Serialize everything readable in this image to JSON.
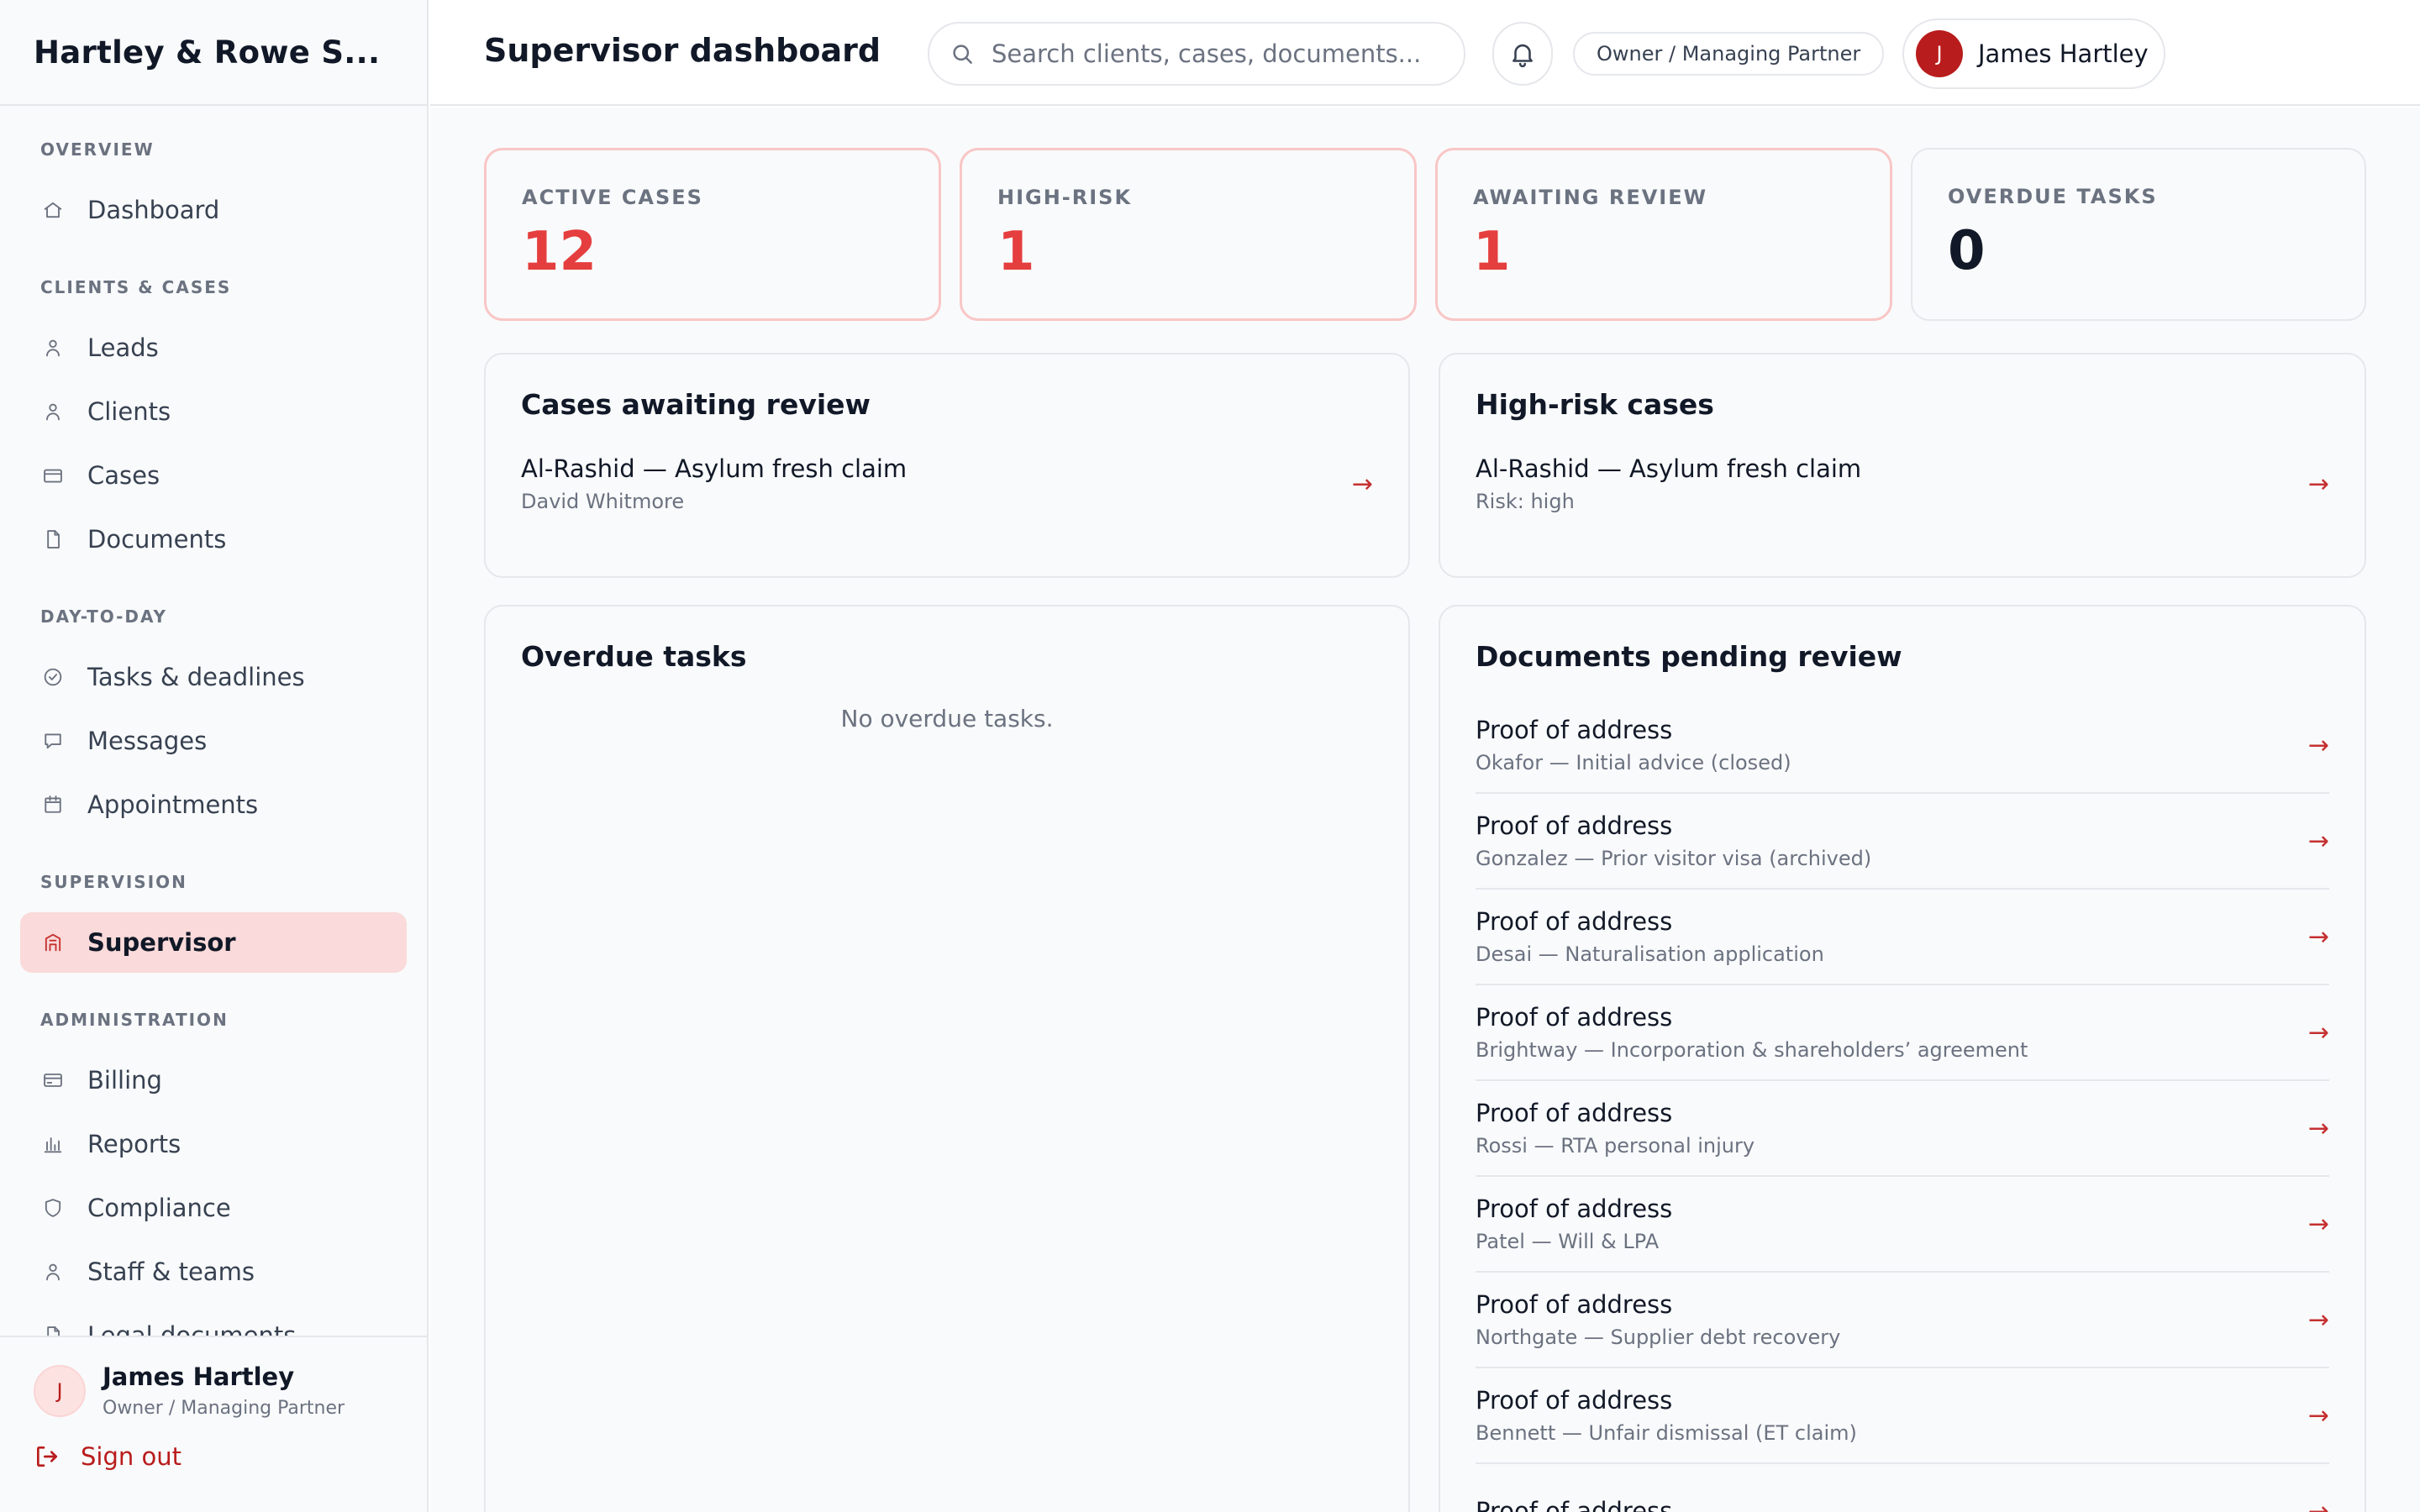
{
  "brand": {
    "name": "Hartley & Rowe S..."
  },
  "sidebar": {
    "sections": [
      {
        "title": "OVERVIEW",
        "items": [
          {
            "label": "Dashboard",
            "icon": "home-icon"
          }
        ]
      },
      {
        "title": "CLIENTS & CASES",
        "items": [
          {
            "label": "Leads",
            "icon": "person-icon"
          },
          {
            "label": "Clients",
            "icon": "person-icon"
          },
          {
            "label": "Cases",
            "icon": "briefcase-icon"
          },
          {
            "label": "Documents",
            "icon": "document-icon"
          }
        ]
      },
      {
        "title": "DAY-TO-DAY",
        "items": [
          {
            "label": "Tasks & deadlines",
            "icon": "check-circle-icon"
          },
          {
            "label": "Messages",
            "icon": "message-icon"
          },
          {
            "label": "Appointments",
            "icon": "calendar-icon"
          }
        ]
      },
      {
        "title": "SUPERVISION",
        "items": [
          {
            "label": "Supervisor",
            "icon": "building-icon",
            "active": true
          }
        ]
      },
      {
        "title": "ADMINISTRATION",
        "items": [
          {
            "label": "Billing",
            "icon": "card-icon"
          },
          {
            "label": "Reports",
            "icon": "bar-chart-icon"
          },
          {
            "label": "Compliance",
            "icon": "shield-icon"
          },
          {
            "label": "Staff & teams",
            "icon": "person-icon"
          },
          {
            "label": "Legal documents",
            "icon": "document-icon"
          }
        ]
      }
    ],
    "footer": {
      "initial": "J",
      "name": "James Hartley",
      "role": "Owner / Managing Partner",
      "signout": "Sign out"
    }
  },
  "header": {
    "title": "Supervisor dashboard",
    "search_placeholder": "Search clients, cases, documents...",
    "role_badge": "Owner / Managing Partner",
    "user": {
      "initial": "J",
      "name": "James Hartley"
    }
  },
  "stats": [
    {
      "label": "ACTIVE CASES",
      "value": "12",
      "alert": true
    },
    {
      "label": "HIGH-RISK",
      "value": "1",
      "alert": true
    },
    {
      "label": "AWAITING REVIEW",
      "value": "1",
      "alert": true
    },
    {
      "label": "OVERDUE TASKS",
      "value": "0",
      "alert": false
    }
  ],
  "awaiting_review": {
    "title": "Cases awaiting review",
    "items": [
      {
        "title": "Al-Rashid — Asylum fresh claim",
        "subtitle": "David Whitmore"
      }
    ]
  },
  "high_risk": {
    "title": "High-risk cases",
    "items": [
      {
        "title": "Al-Rashid — Asylum fresh claim",
        "subtitle": "Risk: high"
      }
    ]
  },
  "overdue": {
    "title": "Overdue tasks",
    "empty": "No overdue tasks."
  },
  "documents_pending": {
    "title": "Documents pending review",
    "items": [
      {
        "title": "Proof of address",
        "subtitle": "Okafor — Initial advice (closed)"
      },
      {
        "title": "Proof of address",
        "subtitle": "Gonzalez — Prior visitor visa (archived)"
      },
      {
        "title": "Proof of address",
        "subtitle": "Desai — Naturalisation application"
      },
      {
        "title": "Proof of address",
        "subtitle": "Brightway — Incorporation & shareholders’ agreement"
      },
      {
        "title": "Proof of address",
        "subtitle": "Rossi — RTA personal injury"
      },
      {
        "title": "Proof of address",
        "subtitle": "Patel — Will & LPA"
      },
      {
        "title": "Proof of address",
        "subtitle": "Northgate — Supplier debt recovery"
      },
      {
        "title": "Proof of address",
        "subtitle": "Bennett — Unfair dismissal (ET claim)"
      },
      {
        "title": "Proof of address",
        "subtitle": ""
      }
    ]
  },
  "arrow": "→",
  "colors": {
    "accent": "#b91c1c",
    "alert_value": "#e53e3e",
    "active_nav_bg": "#fadada"
  }
}
